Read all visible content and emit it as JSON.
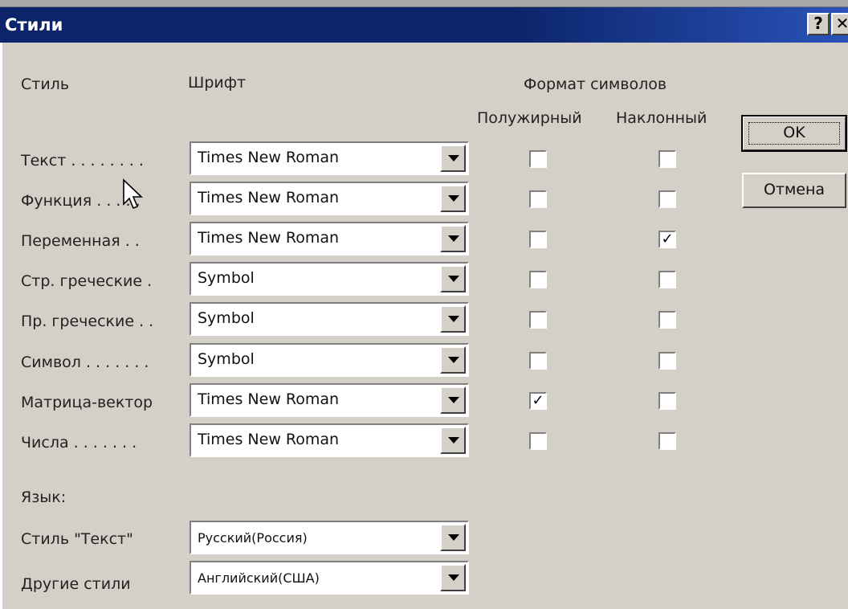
{
  "window": {
    "title": "Стили",
    "help_button": "?",
    "close_button": "✕"
  },
  "headers": {
    "style": "Стиль",
    "font": "Шрифт",
    "char_format": "Формат символов",
    "bold": "Полужирный",
    "italic": "Наклонный"
  },
  "rows": [
    {
      "label": "Текст . . . . . . . .",
      "font": "Times New Roman",
      "bold": false,
      "italic": false
    },
    {
      "label": "Функция . . . . .",
      "font": "Times New Roman",
      "bold": false,
      "italic": false
    },
    {
      "label": "Переменная . .",
      "font": "Times New Roman",
      "bold": false,
      "italic": true
    },
    {
      "label": "Стр. греческие .",
      "font": "Symbol",
      "bold": false,
      "italic": false
    },
    {
      "label": "Пр. греческие . .",
      "font": "Symbol",
      "bold": false,
      "italic": false
    },
    {
      "label": "Символ . . . . . . .",
      "font": "Symbol",
      "bold": false,
      "italic": false
    },
    {
      "label": "Матрица-вектор",
      "font": "Times New Roman",
      "bold": true,
      "italic": false
    },
    {
      "label": "Числа . . . . . . .",
      "font": "Times New Roman",
      "bold": false,
      "italic": false
    }
  ],
  "language": {
    "heading": "Язык:",
    "text_style_label": "Стиль \"Текст\"",
    "text_style_value": "Русский(Россия)",
    "other_styles_label": "Другие стили",
    "other_styles_value": "Английский(США)"
  },
  "buttons": {
    "ok": "OK",
    "cancel": "Отмена"
  },
  "colors": {
    "title_bar": "#0b246a",
    "dialog_bg": "#d4d0c8"
  }
}
